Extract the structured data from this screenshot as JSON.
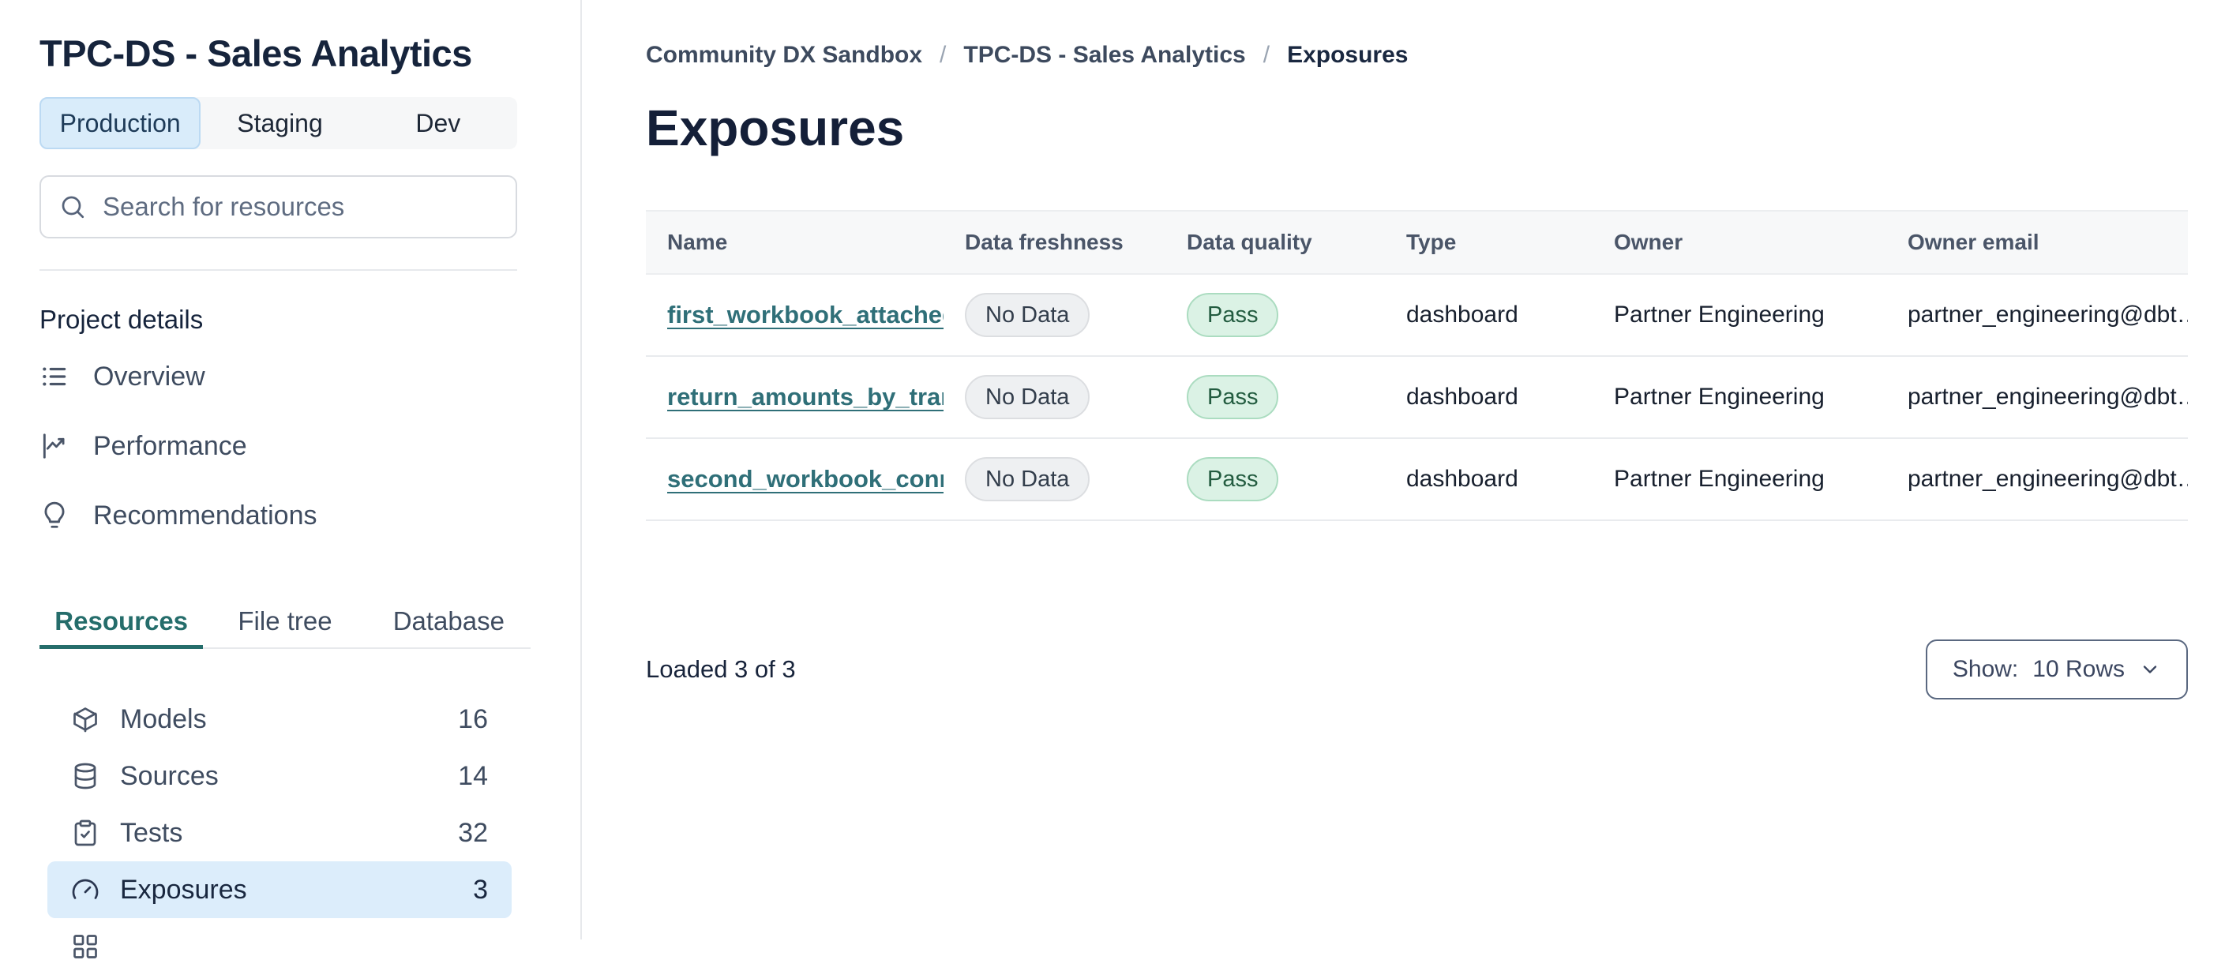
{
  "sidebar": {
    "project_title": "TPC-DS - Sales Analytics",
    "env_tabs": [
      {
        "label": "Production",
        "active": true
      },
      {
        "label": "Staging",
        "active": false
      },
      {
        "label": "Dev",
        "active": false
      }
    ],
    "search": {
      "placeholder": "Search for resources"
    },
    "section_label": "Project details",
    "nav_items": [
      {
        "label": "Overview",
        "icon": "list-icon"
      },
      {
        "label": "Performance",
        "icon": "line-chart-icon"
      },
      {
        "label": "Recommendations",
        "icon": "lightbulb-icon"
      }
    ],
    "resource_tabs": [
      {
        "label": "Resources",
        "active": true
      },
      {
        "label": "File tree",
        "active": false
      },
      {
        "label": "Database",
        "active": false
      }
    ],
    "resources": [
      {
        "label": "Models",
        "count": "16",
        "icon": "cube-icon",
        "active": false
      },
      {
        "label": "Sources",
        "count": "14",
        "icon": "database-icon",
        "active": false
      },
      {
        "label": "Tests",
        "count": "32",
        "icon": "clipboard-check-icon",
        "active": false
      },
      {
        "label": "Exposures",
        "count": "3",
        "icon": "gauge-icon",
        "active": true
      }
    ]
  },
  "main": {
    "breadcrumb": [
      "Community DX Sandbox",
      "TPC-DS - Sales Analytics",
      "Exposures"
    ],
    "breadcrumb_separator": "/",
    "page_title": "Exposures",
    "table": {
      "columns": [
        "Name",
        "Data freshness",
        "Data quality",
        "Type",
        "Owner",
        "Owner email"
      ],
      "rows": [
        {
          "name": "first_workbook_attached…",
          "freshness": "No Data",
          "quality": "Pass",
          "type": "dashboard",
          "owner": "Partner Engineering",
          "email": "partner_engineering@dbt…"
        },
        {
          "name": "return_amounts_by_tran…",
          "freshness": "No Data",
          "quality": "Pass",
          "type": "dashboard",
          "owner": "Partner Engineering",
          "email": "partner_engineering@dbt…"
        },
        {
          "name": "second_workbook_conn…",
          "freshness": "No Data",
          "quality": "Pass",
          "type": "dashboard",
          "owner": "Partner Engineering",
          "email": "partner_engineering@dbt…"
        }
      ]
    },
    "footer": {
      "loaded_text": "Loaded 3 of 3",
      "show_label": "Show:",
      "show_value": "10 Rows"
    }
  },
  "colors": {
    "accent_teal": "#2f6f78",
    "active_tab_teal": "#256d6b",
    "active_item_blue": "#dcedfb",
    "env_active_blue": "#d9ecfa",
    "pass_badge_bg": "#dbf2e5",
    "pass_badge_text": "#235c40",
    "nodata_badge_bg": "#eef0f2",
    "nodata_badge_text": "#323d4b",
    "heading_navy": "#141f38"
  }
}
